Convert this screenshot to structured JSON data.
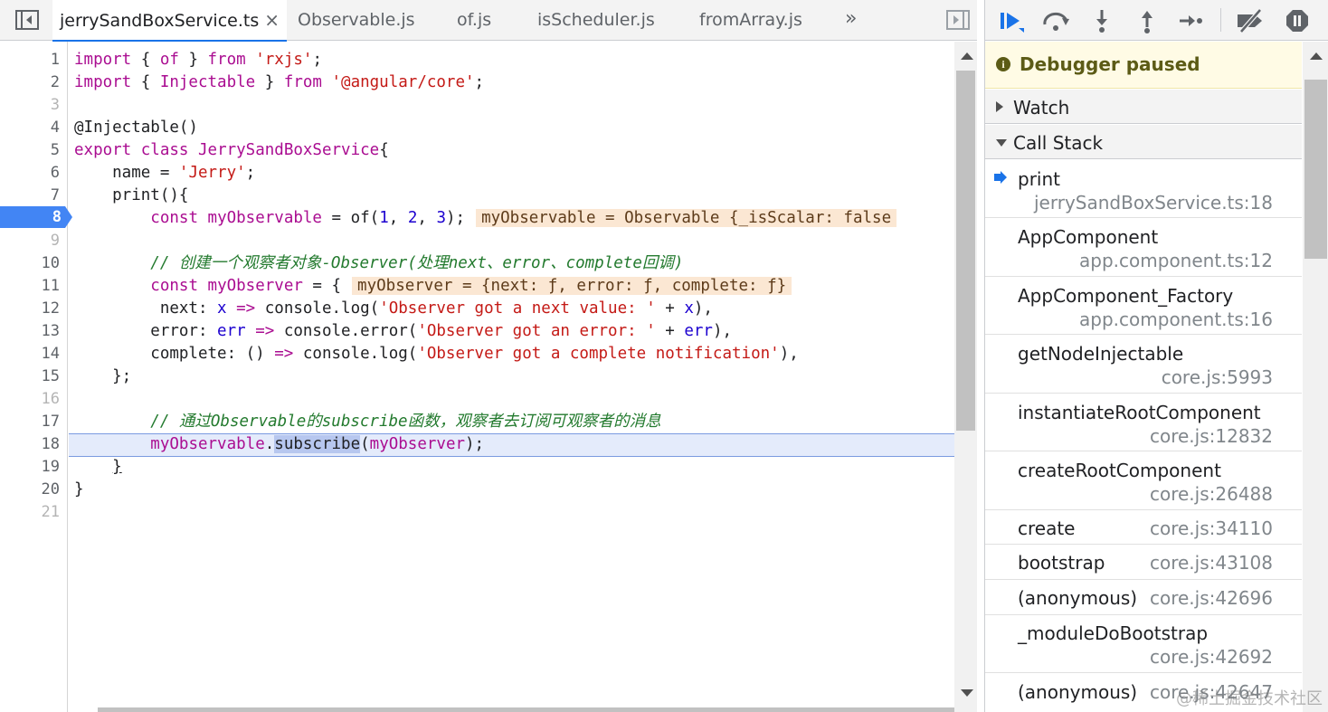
{
  "editor": {
    "tabs": [
      {
        "label": "jerrySandBoxService.ts",
        "active": true,
        "close": "×"
      },
      {
        "label": "Observable.js",
        "active": false
      },
      {
        "label": "of.js",
        "active": false
      },
      {
        "label": "isScheduler.js",
        "active": false
      },
      {
        "label": "fromArray.js",
        "active": false
      }
    ],
    "more_tabs": "»",
    "line_numbers": [
      "1",
      "2",
      "3",
      "4",
      "5",
      "6",
      "7",
      "8",
      "9",
      "10",
      "11",
      "12",
      "13",
      "14",
      "15",
      "16",
      "17",
      "18",
      "19",
      "20",
      "21"
    ],
    "breakpoint_line": "8",
    "paused_line": "18",
    "code": {
      "l1": [
        "import",
        " { ",
        "of",
        " } ",
        "from",
        " ",
        "'rxjs'",
        ";"
      ],
      "l2": [
        "import",
        " { ",
        "Injectable",
        " } ",
        "from",
        " ",
        "'@angular/core'",
        ";"
      ],
      "l4": "@Injectable()",
      "l5": [
        "export",
        " ",
        "class",
        " ",
        "JerrySandBoxService",
        "{"
      ],
      "l6": [
        "    name = ",
        "'Jerry'",
        ";"
      ],
      "l7": [
        "    print(){"
      ],
      "l8": [
        "        ",
        "const",
        " ",
        "myObservable",
        " = of(",
        "1",
        ", ",
        "2",
        ", ",
        "3",
        ");"
      ],
      "l8_inline": "myObservable = Observable {_isScalar: false",
      "l10": "        // 创建一个观察者对象-Observer(处理next、error、complete回调)",
      "l11": [
        "        ",
        "const",
        " ",
        "myObserver",
        " = {"
      ],
      "l11_inline": "myObserver = {next: ƒ, error: ƒ, complete: ƒ}",
      "l12": [
        "         next: ",
        "x",
        " ",
        "=>",
        " console.log(",
        "'Observer got a next value: '",
        " + ",
        "x",
        "),"
      ],
      "l13": [
        "        error: ",
        "err",
        " ",
        "=>",
        " console.error(",
        "'Observer got an error: '",
        " + ",
        "err",
        "),"
      ],
      "l14": [
        "        complete: () ",
        "=>",
        " console.log(",
        "'Observer got a complete notification'",
        "),"
      ],
      "l15": "    };",
      "l17": "        // 通过Observable的subscribe函数，观察者去订阅可观察者的消息",
      "l18": [
        "        ",
        "myObservable",
        ".",
        "subscribe",
        "(",
        "myObserver",
        ");"
      ],
      "l19": [
        "    ",
        "}"
      ],
      "l20": "}"
    }
  },
  "debugger": {
    "toolbar_icons": [
      "resume-icon",
      "step-over-icon",
      "step-into-icon",
      "step-out-icon",
      "step-icon",
      "deactivate-breakpoints-icon",
      "pause-on-exceptions-icon"
    ],
    "paused_message": "Debugger paused",
    "watch_label": "Watch",
    "call_stack_label": "Call Stack",
    "frames": [
      {
        "name": "print",
        "location": "jerrySandBoxService.ts:18",
        "current": true,
        "two_line": true
      },
      {
        "name": "AppComponent",
        "location": "app.component.ts:12",
        "two_line": true
      },
      {
        "name": "AppComponent_Factory",
        "location": "app.component.ts:16",
        "two_line": true
      },
      {
        "name": "getNodeInjectable",
        "location": "core.js:5993",
        "two_line": true
      },
      {
        "name": "instantiateRootComponent",
        "location": "core.js:12832",
        "two_line": true
      },
      {
        "name": "createRootComponent",
        "location": "core.js:26488",
        "two_line": true
      },
      {
        "name": "create",
        "location": "core.js:34110",
        "two_line": false
      },
      {
        "name": "bootstrap",
        "location": "core.js:43108",
        "two_line": false
      },
      {
        "name": "(anonymous)",
        "location": "core.js:42696",
        "two_line": false
      },
      {
        "name": "_moduleDoBootstrap",
        "location": "core.js:42692",
        "two_line": true
      },
      {
        "name": "(anonymous)",
        "location": "core.js:42647",
        "two_line": false
      }
    ]
  },
  "watermark": "@稀土掘金技术社区",
  "colors": {
    "accent": "#1a73e8",
    "paused_banner_bg": "#fffbe5",
    "paused_text": "#5c5b16",
    "exec_line_bg": "#e4ebfb",
    "inline_value_bg": "#fbe7d3"
  }
}
